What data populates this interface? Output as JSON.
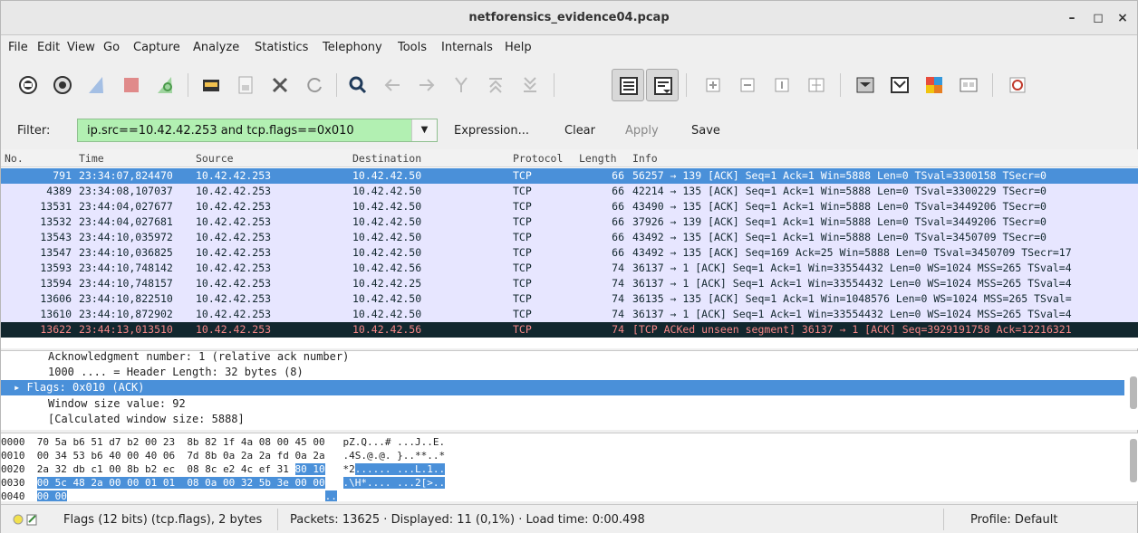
{
  "window": {
    "title": "netforensics_evidence04.pcap",
    "minimize": "–",
    "maximize": "◻",
    "close": "×"
  },
  "menu": [
    "File",
    "Edit",
    "View",
    "Go",
    "Capture",
    "Analyze",
    "Statistics",
    "Telephony",
    "Tools",
    "Internals",
    "Help"
  ],
  "filter": {
    "label": "Filter:",
    "value": "ip.src==10.42.42.253 and tcp.flags==0x010",
    "expression": "Expression...",
    "clear": "Clear",
    "apply": "Apply",
    "save": "Save",
    "dropdown": "▼"
  },
  "columns": [
    "No.",
    "Time",
    "Source",
    "Destination",
    "Protocol",
    "Length",
    "Info"
  ],
  "packets": [
    {
      "no": "791",
      "time": "23:34:07,824470",
      "src": "10.42.42.253",
      "dst": "10.42.42.50",
      "proto": "TCP",
      "len": "66",
      "info": "56257 → 139 [ACK] Seq=1 Ack=1 Win=5888 Len=0 TSval=3300158 TSecr=0"
    },
    {
      "no": "4389",
      "time": "23:34:08,107037",
      "src": "10.42.42.253",
      "dst": "10.42.42.50",
      "proto": "TCP",
      "len": "66",
      "info": "42214 → 135 [ACK] Seq=1 Ack=1 Win=5888 Len=0 TSval=3300229 TSecr=0"
    },
    {
      "no": "13531",
      "time": "23:44:04,027677",
      "src": "10.42.42.253",
      "dst": "10.42.42.50",
      "proto": "TCP",
      "len": "66",
      "info": "43490 → 135 [ACK] Seq=1 Ack=1 Win=5888 Len=0 TSval=3449206 TSecr=0"
    },
    {
      "no": "13532",
      "time": "23:44:04,027681",
      "src": "10.42.42.253",
      "dst": "10.42.42.50",
      "proto": "TCP",
      "len": "66",
      "info": "37926 → 139 [ACK] Seq=1 Ack=1 Win=5888 Len=0 TSval=3449206 TSecr=0"
    },
    {
      "no": "13543",
      "time": "23:44:10,035972",
      "src": "10.42.42.253",
      "dst": "10.42.42.50",
      "proto": "TCP",
      "len": "66",
      "info": "43492 → 135 [ACK] Seq=1 Ack=1 Win=5888 Len=0 TSval=3450709 TSecr=0"
    },
    {
      "no": "13547",
      "time": "23:44:10,036825",
      "src": "10.42.42.253",
      "dst": "10.42.42.50",
      "proto": "TCP",
      "len": "66",
      "info": "43492 → 135 [ACK] Seq=169 Ack=25 Win=5888 Len=0 TSval=3450709 TSecr=17"
    },
    {
      "no": "13593",
      "time": "23:44:10,748142",
      "src": "10.42.42.253",
      "dst": "10.42.42.56",
      "proto": "TCP",
      "len": "74",
      "info": "36137 → 1 [ACK] Seq=1 Ack=1 Win=33554432 Len=0 WS=1024 MSS=265 TSval=4"
    },
    {
      "no": "13594",
      "time": "23:44:10,748157",
      "src": "10.42.42.253",
      "dst": "10.42.42.25",
      "proto": "TCP",
      "len": "74",
      "info": "36137 → 1 [ACK] Seq=1 Ack=1 Win=33554432 Len=0 WS=1024 MSS=265 TSval=4"
    },
    {
      "no": "13606",
      "time": "23:44:10,822510",
      "src": "10.42.42.253",
      "dst": "10.42.42.50",
      "proto": "TCP",
      "len": "74",
      "info": "36135 → 135 [ACK] Seq=1 Ack=1 Win=1048576 Len=0 WS=1024 MSS=265 TSval="
    },
    {
      "no": "13610",
      "time": "23:44:10,872902",
      "src": "10.42.42.253",
      "dst": "10.42.42.50",
      "proto": "TCP",
      "len": "74",
      "info": "36137 → 1 [ACK] Seq=1 Ack=1 Win=33554432 Len=0 WS=1024 MSS=265 TSval=4"
    },
    {
      "no": "13622",
      "time": "23:44:13,013510",
      "src": "10.42.42.253",
      "dst": "10.42.42.56",
      "proto": "TCP",
      "len": "74",
      "info": "[TCP ACKed unseen segment] 36137 → 1 [ACK] Seq=3929191758 Ack=12216321"
    }
  ],
  "details": [
    "Acknowledgment number: 1    (relative ack number)",
    "1000 .... = Header Length: 32 bytes (8)",
    "▸ Flags: 0x010 (ACK)",
    "Window size value: 92",
    "[Calculated window size: 5888]"
  ],
  "hex": {
    "offsets": [
      "0000",
      "0010",
      "0020",
      "0030",
      "0040"
    ],
    "r0": {
      "a": "70 5a b6 51 d7 b2 00 23  8b 82 1f 4a 08 00 45 00",
      "ascii": "pZ.Q...# ...J..E."
    },
    "r1": {
      "a": "00 34 53 b6 40 00 40 06  7d 8b 0a 2a 2a fd 0a 2a",
      "ascii": ".4S.@.@. }..**..*"
    },
    "r2": {
      "a": "2a 32 ",
      "b": "db c1 00 8b b2 ec  08 8c e2 4c ef 31 ",
      "c": "80 10",
      "ascii_a": "*2",
      "ascii_b": "...... ...L.1..",
      "ascii_c": ""
    },
    "r3": {
      "a": "00 5c 48 2a 00 00 01 01  08 0a 00 32 5b 3e 00 00",
      "ascii": ".\\H*.... ...2[>.."
    },
    "r4": {
      "a": "00 00",
      "ascii": ".."
    }
  },
  "status": {
    "field": "Flags (12 bits) (tcp.flags), 2 bytes",
    "packets": "Packets: 13625 · Displayed: 11 (0,1%) · Load time: 0:00.498",
    "profile": "Profile: Default"
  },
  "colors": {
    "selection": "#4a90d9",
    "tcp_row": "#e7e6ff",
    "bad_row": "#12272e",
    "filter_ok": "#b2f0b2"
  }
}
